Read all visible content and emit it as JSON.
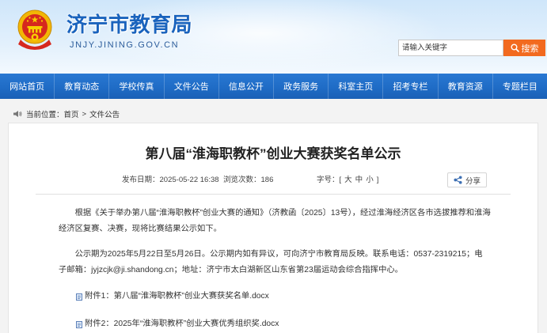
{
  "site": {
    "title": "济宁市教育局",
    "domain": "JNJY.JINING.GOV.CN"
  },
  "search": {
    "placeholder": "请输入关键字",
    "button_label": "搜索"
  },
  "nav": {
    "items": [
      "网站首页",
      "教育动态",
      "学校传真",
      "文件公告",
      "信息公开",
      "政务服务",
      "科室主页",
      "招考专栏",
      "教育资源",
      "专题栏目"
    ]
  },
  "breadcrumb": {
    "label": "当前位置：",
    "items": [
      "首页",
      "文件公告"
    ],
    "separator": ">"
  },
  "article": {
    "title": "第八届“淮海职教杯”创业大赛获奖名单公示",
    "meta": {
      "date_label": "发布日期：",
      "date": "2025-05-22 16:38",
      "views_label": "浏览次数：",
      "views": "186",
      "font_size_label": "字号：",
      "bracket_open": "[",
      "font_sizes": [
        "大",
        "中",
        "小"
      ],
      "bracket_close": "]"
    },
    "share_label": "分享",
    "paragraphs": [
      "根据《关于举办第八届“淮海职教杯”创业大赛的通知》（济教函〔2025〕13号），经过淮海经济区各市选拔推荐和淮海经济区复赛、决赛，现将比赛结果公示如下。",
      "公示期为2025年5月22日至5月26日。公示期内如有异议，可向济宁市教育局反映。联系电话：0537-2319215；电子邮箱：jyjzcjk@ji.shandong.cn；地址：济宁市太白湖新区山东省第23届运动会综合指挥中心。"
    ],
    "attachments": [
      "附件1：第八届“淮海职教杯”创业大赛获奖名单.docx",
      "附件2：2025年“淮海职教杯”创业大赛优秀组织奖.docx"
    ]
  },
  "icons": {
    "logo": "national-emblem-icon",
    "search": "search-icon",
    "breadcrumb": "speaker-icon",
    "share": "share-icon",
    "attachment": "document-icon"
  },
  "colors": {
    "header_text": "#1a63bd",
    "nav_bg": "#1f6cc6",
    "search_btn": "#f26a1f",
    "page_bg": "#f3f3f3"
  }
}
